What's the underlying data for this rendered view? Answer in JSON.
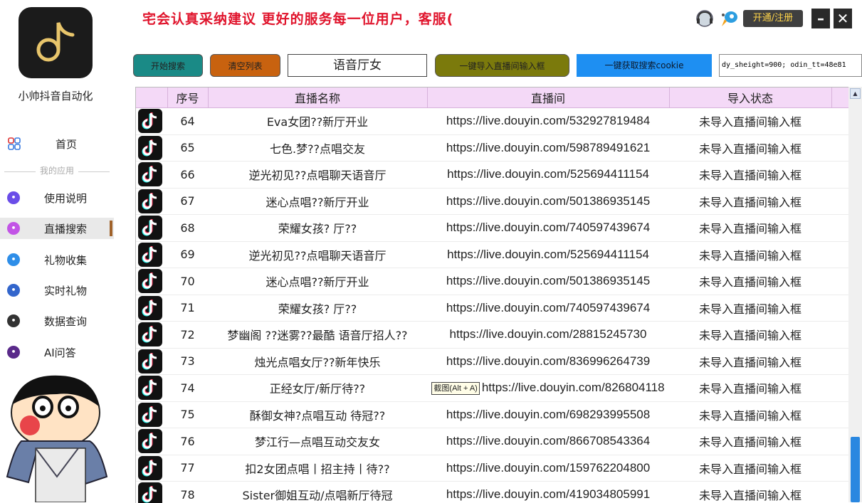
{
  "app": {
    "name": "小帅抖音自动化",
    "marquee": "宅会认真采纳建议 更好的服务每一位用户，客服("
  },
  "topbar": {
    "register_label": "开通/注册",
    "minimize_label": "–",
    "close_label": "✕",
    "icons": [
      "headset-icon",
      "rocket-icon"
    ]
  },
  "sidebar": {
    "home": {
      "label": "首页",
      "icon": "grid-icon"
    },
    "section_title": "我的应用",
    "items": [
      {
        "label": "使用说明",
        "icon": "manual-icon",
        "color": "#6a4de8"
      },
      {
        "label": "直播搜索",
        "icon": "live-search-icon",
        "color": "#c254e6",
        "active": true
      },
      {
        "label": "礼物收集",
        "icon": "gift-icon",
        "color": "#2e8ee8"
      },
      {
        "label": "实时礼物",
        "icon": "realtime-gift-icon",
        "color": "#3366cc"
      },
      {
        "label": "数据查询",
        "icon": "data-query-icon",
        "color": "#333333"
      },
      {
        "label": "AI问答",
        "icon": "ai-icon",
        "color": "#5a2a8a"
      }
    ]
  },
  "toolbar": {
    "start_search": "开始搜索",
    "clear_list": "清空列表",
    "keyword": "语音厅女",
    "import_btn": "一键导入直播间输入框",
    "cookie_btn": "一键获取搜索cookie",
    "cookie_value": "dy_sheight=900; odin_tt=48e81"
  },
  "table": {
    "headers": [
      "序号",
      "直播名称",
      "直播间",
      "导入状态"
    ],
    "tooltip": "截图(Alt + A)",
    "rows": [
      {
        "no": "64",
        "name": "Eva女团??新厅开业",
        "url": "https://live.douyin.com/532927819484",
        "status": "未导入直播间输入框"
      },
      {
        "no": "65",
        "name": "七色.梦??点唱交友",
        "url": "https://live.douyin.com/598789491621",
        "status": "未导入直播间输入框"
      },
      {
        "no": "66",
        "name": "逆光初见??点唱聊天语音厅",
        "url": "https://live.douyin.com/525694411154",
        "status": "未导入直播间输入框"
      },
      {
        "no": "67",
        "name": "迷心点唱??新厅开业",
        "url": "https://live.douyin.com/501386935145",
        "status": "未导入直播间输入框"
      },
      {
        "no": "68",
        "name": "荣耀女孩? 厅??",
        "url": "https://live.douyin.com/740597439674",
        "status": "未导入直播间输入框"
      },
      {
        "no": "69",
        "name": "逆光初见??点唱聊天语音厅",
        "url": "https://live.douyin.com/525694411154",
        "status": "未导入直播间输入框"
      },
      {
        "no": "70",
        "name": "迷心点唱??新厅开业",
        "url": "https://live.douyin.com/501386935145",
        "status": "未导入直播间输入框"
      },
      {
        "no": "71",
        "name": "荣耀女孩? 厅??",
        "url": "https://live.douyin.com/740597439674",
        "status": "未导入直播间输入框"
      },
      {
        "no": "72",
        "name": "梦幽阁 ??迷雾??最酷 语音厅招人??",
        "url": "https://live.douyin.com/28815245730",
        "status": "未导入直播间输入框"
      },
      {
        "no": "73",
        "name": "烛光点唱女厅??新年快乐",
        "url": "https://live.douyin.com/836996264739",
        "status": "未导入直播间输入框"
      },
      {
        "no": "74",
        "name": "正经女厅/新厅待??",
        "url": "https://live.douyin.com/826804118",
        "status": "未导入直播间输入框",
        "tooltip": true
      },
      {
        "no": "75",
        "name": "酥御女神?点唱互动 待冠??",
        "url": "https://live.douyin.com/698293995508",
        "status": "未导入直播间输入框"
      },
      {
        "no": "76",
        "name": "梦江行—点唱互动交友女",
        "url": "https://live.douyin.com/866708543364",
        "status": "未导入直播间输入框"
      },
      {
        "no": "77",
        "name": "扣2女团点唱丨招主持丨待??",
        "url": "https://live.douyin.com/159762204800",
        "status": "未导入直播间输入框"
      },
      {
        "no": "78",
        "name": "Sister御姐互动/点唱新厅待冠",
        "url": "https://live.douyin.com/419034805991",
        "status": "未导入直播间输入框"
      }
    ]
  }
}
